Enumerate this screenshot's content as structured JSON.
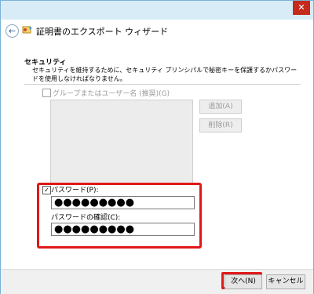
{
  "window": {
    "close_glyph": "✕",
    "title": "証明書のエクスポート ウィザード",
    "back_glyph": "←"
  },
  "security": {
    "title": "セキュリティ",
    "description": "セキュリティを維持するために、セキュリティ プリンシパルで秘密キーを保護するかパスワードを使用しなければなりません。",
    "group_checkbox_label": "グループまたはユーザー名 (推奨)(G)",
    "group_checked": false,
    "add_button": "追加(A)",
    "remove_button": "削除(R)"
  },
  "password": {
    "checkbox_label": "パスワード(P):",
    "checked": true,
    "check_glyph": "✓",
    "value": "●●●●●●●●●",
    "confirm_label": "パスワードの確認(C):",
    "confirm_value": "●●●●●●●●●"
  },
  "footer": {
    "next_button": "次へ(N)",
    "cancel_button": "キャンセル"
  },
  "colors": {
    "highlight": "#e01818",
    "titlebar": "#d8ecf8",
    "close": "#c42b1c"
  }
}
